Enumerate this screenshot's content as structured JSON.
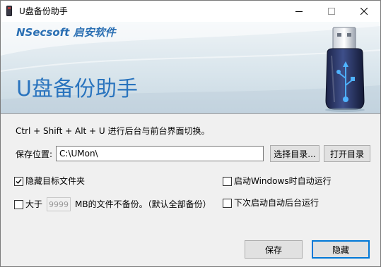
{
  "window": {
    "title": "U盘备份助手"
  },
  "banner": {
    "brand": "NSecsoft 启安软件",
    "title": "U盘备份助手"
  },
  "hint": "Ctrl + Shift + Alt + U 进行后台与前台界面切换。",
  "save_location": {
    "label": "保存位置:",
    "value": "C:\\UMon\\",
    "browse_label": "选择目录...",
    "open_label": "打开目录"
  },
  "options": {
    "hide_folder": {
      "label": "隐藏目标文件夹",
      "checked": true
    },
    "autostart": {
      "label": "启动Windows时自动运行",
      "checked": false
    },
    "size_limit": {
      "label_before": "大于",
      "value": "9999",
      "label_after": "MB的文件不备份。（默认全部备份）",
      "checked": false
    },
    "next_hidden": {
      "label": "下次启动自动后台运行",
      "checked": false
    }
  },
  "footer": {
    "save_label": "保存",
    "hide_label": "隐藏"
  },
  "icons": {
    "app": "usb-drive-icon",
    "minimize": "minimize-icon",
    "maximize": "maximize-icon",
    "close": "close-icon",
    "banner_art": "usb-drive-illustration",
    "check": "checkmark-icon"
  },
  "colors": {
    "accent": "#2a74be",
    "brand": "#2a6fb3",
    "focus_border": "#0078d7"
  }
}
